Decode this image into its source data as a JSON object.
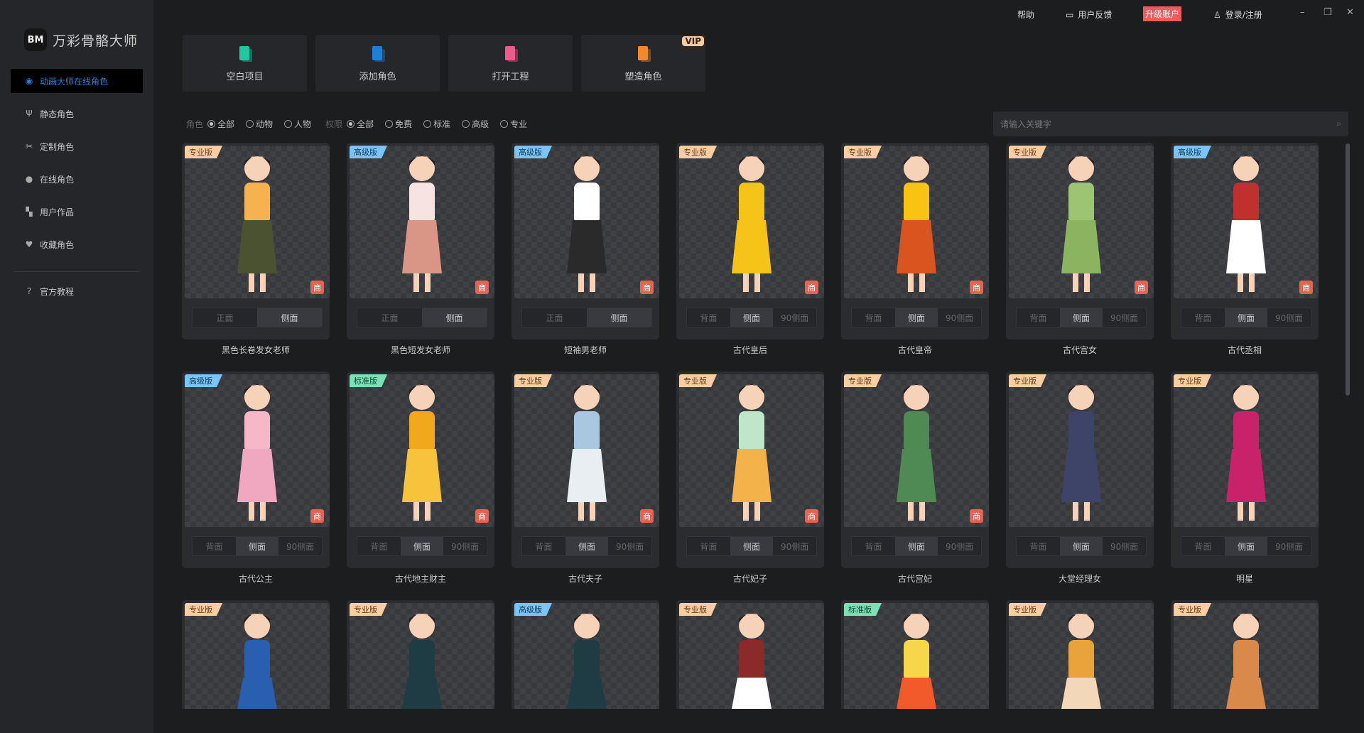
{
  "app": {
    "logo_mark": "BM",
    "title": "万彩骨骼大师"
  },
  "sidebar": {
    "items": [
      {
        "label": "动画大师在线角色",
        "icon": "globe-icon",
        "active": true
      },
      {
        "label": "静态角色",
        "icon": "person-static-icon"
      },
      {
        "label": "定制角色",
        "icon": "tools-icon"
      },
      {
        "label": "在线角色",
        "icon": "user-icon"
      },
      {
        "label": "用户作品",
        "icon": "grid-icon"
      },
      {
        "label": "收藏角色",
        "icon": "heart-icon"
      }
    ],
    "tutorial": {
      "label": "官方教程",
      "icon": "help-circle-icon"
    }
  },
  "topbar": {
    "help": "帮助",
    "feedback": "用户反馈",
    "upgrade": "升级账户",
    "login": "登录/注册"
  },
  "actions": [
    {
      "label": "空白项目",
      "color": "#1fc8a0"
    },
    {
      "label": "添加角色",
      "color": "#1e7fd8"
    },
    {
      "label": "打开工程",
      "color": "#ef5b8d"
    },
    {
      "label": "塑造角色",
      "color": "#f08a2a",
      "vip": "VIP"
    }
  ],
  "filters": {
    "role_label": "角色",
    "role_options": [
      "全部",
      "动物",
      "人物"
    ],
    "role_selected": 0,
    "perm_label": "权限",
    "perm_options": [
      "全部",
      "免费",
      "标准",
      "高级",
      "专业"
    ],
    "perm_selected": 0
  },
  "search": {
    "placeholder": "请输入关键字"
  },
  "badge_colors": {
    "专业版": [
      "#f7cda3",
      "#6b3e14"
    ],
    "高级版": [
      "#7cc4f5",
      "#0f3a5a"
    ],
    "标准版": [
      "#7de0b5",
      "#0f4a33"
    ]
  },
  "cards": [
    {
      "name": "黑色长卷发女老师",
      "badge": "专业版",
      "views": [
        "正面",
        "侧面"
      ],
      "active": 1,
      "shang": "商",
      "colors": [
        "#f4b350",
        "#4a5232"
      ]
    },
    {
      "name": "黑色短发女老师",
      "badge": "高级版",
      "views": [
        "正面",
        "侧面"
      ],
      "active": 1,
      "shang": "商",
      "colors": [
        "#f7e4e0",
        "#d99585"
      ]
    },
    {
      "name": "短袖男老师",
      "badge": "高级版",
      "views": [
        "正面",
        "侧面"
      ],
      "active": 1,
      "shang": "商",
      "colors": [
        "#ffffff",
        "#2a2a2a"
      ]
    },
    {
      "name": "古代皇后",
      "badge": "专业版",
      "views": [
        "背面",
        "侧面",
        "90侧面"
      ],
      "active": 1,
      "shang": "商",
      "colors": [
        "#f6c318",
        "#f6c318"
      ]
    },
    {
      "name": "古代皇帝",
      "badge": "专业版",
      "views": [
        "背面",
        "侧面",
        "90侧面"
      ],
      "active": 1,
      "shang": "商",
      "colors": [
        "#f7c511",
        "#d9541e"
      ]
    },
    {
      "name": "古代宫女",
      "badge": "专业版",
      "views": [
        "背面",
        "侧面",
        "90侧面"
      ],
      "active": 1,
      "shang": "商",
      "colors": [
        "#9cc472",
        "#8ab460"
      ]
    },
    {
      "name": "古代丞相",
      "badge": "高级版",
      "views": [
        "背面",
        "侧面",
        "90侧面"
      ],
      "active": 1,
      "shang": "商",
      "colors": [
        "#c0302f",
        "#ffffff"
      ]
    },
    {
      "name": "古代公主",
      "badge": "高级版",
      "views": [
        "背面",
        "侧面",
        "90侧面"
      ],
      "active": 1,
      "shang": "商",
      "colors": [
        "#f6b8c8",
        "#f0a8c0"
      ]
    },
    {
      "name": "古代地主财主",
      "badge": "标准版",
      "views": [
        "背面",
        "侧面",
        "90侧面"
      ],
      "active": 1,
      "shang": "商",
      "colors": [
        "#f2a81c",
        "#f6c33a"
      ]
    },
    {
      "name": "古代夫子",
      "badge": "专业版",
      "views": [
        "背面",
        "侧面",
        "90侧面"
      ],
      "active": 1,
      "shang": "商",
      "colors": [
        "#a9c7df",
        "#e9eef2"
      ]
    },
    {
      "name": "古代妃子",
      "badge": "专业版",
      "views": [
        "背面",
        "侧面",
        "90侧面"
      ],
      "active": 1,
      "shang": "商",
      "colors": [
        "#bfe6c8",
        "#f3b24a"
      ]
    },
    {
      "name": "古代宫妃",
      "badge": "专业版",
      "views": [
        "背面",
        "侧面",
        "90侧面"
      ],
      "active": 1,
      "shang": "商",
      "colors": [
        "#4f8a55",
        "#4f8a55"
      ]
    },
    {
      "name": "大堂经理女",
      "badge": "专业版",
      "views": [
        "背面",
        "侧面",
        "90侧面"
      ],
      "active": 1,
      "colors": [
        "#3e4468",
        "#3e4468"
      ]
    },
    {
      "name": "明星",
      "badge": "专业版",
      "views": [
        "背面",
        "侧面",
        "90侧面"
      ],
      "active": 1,
      "colors": [
        "#c8226a",
        "#c8226a"
      ]
    },
    {
      "badge": "专业版",
      "colors": [
        "#2a5fb0",
        "#2a5fb0"
      ]
    },
    {
      "badge": "专业版",
      "colors": [
        "#1f3b44",
        "#1f3b44"
      ]
    },
    {
      "badge": "高级版",
      "colors": [
        "#1f3b44",
        "#1f3b44"
      ]
    },
    {
      "badge": "专业版",
      "colors": [
        "#8a2a2a",
        "#ffffff"
      ]
    },
    {
      "badge": "标准版",
      "colors": [
        "#f8d64a",
        "#f25a2a"
      ]
    },
    {
      "badge": "专业版",
      "colors": [
        "#e8a33a",
        "#f2d8b8"
      ]
    },
    {
      "badge": "专业版",
      "colors": [
        "#d98a4a",
        "#d98a4a"
      ]
    }
  ]
}
